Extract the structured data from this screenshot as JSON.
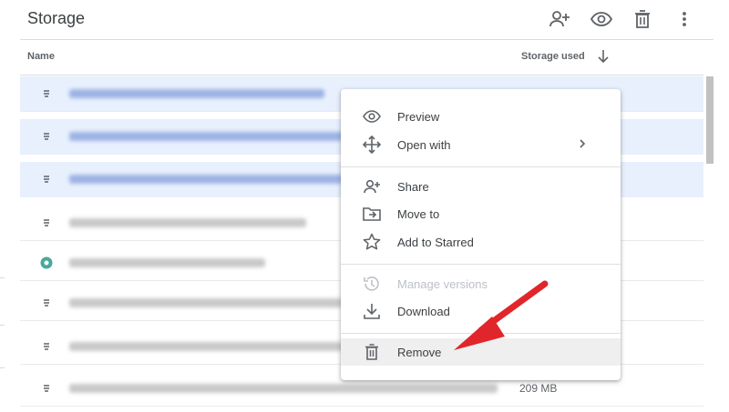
{
  "header": {
    "title": "Storage",
    "icons": [
      "add-person-icon",
      "eye-icon",
      "trash-icon",
      "more-vert-icon"
    ]
  },
  "table": {
    "col_name": "Name",
    "col_storage": "Storage used",
    "rows": [
      {
        "selected": true,
        "icon": "doc-icon",
        "size": ""
      },
      {
        "selected": true,
        "icon": "doc-icon",
        "size": ""
      },
      {
        "selected": true,
        "icon": "doc-icon",
        "size": ""
      },
      {
        "selected": false,
        "icon": "doc-icon",
        "size": ""
      },
      {
        "selected": false,
        "icon": "teal-circle-icon",
        "size": ""
      },
      {
        "selected": false,
        "icon": "doc-icon",
        "size": ""
      },
      {
        "selected": false,
        "icon": "doc-icon",
        "size": ""
      },
      {
        "selected": false,
        "icon": "doc-icon",
        "size": "209 MB"
      }
    ]
  },
  "menu": {
    "preview": "Preview",
    "open_with": "Open with",
    "share": "Share",
    "move_to": "Move to",
    "add_starred": "Add to Starred",
    "manage_versions": "Manage versions",
    "download": "Download",
    "remove": "Remove"
  },
  "colors": {
    "selected_row": "#e8f0fe",
    "arrow": "#e0262a",
    "hover": "#efefef"
  }
}
